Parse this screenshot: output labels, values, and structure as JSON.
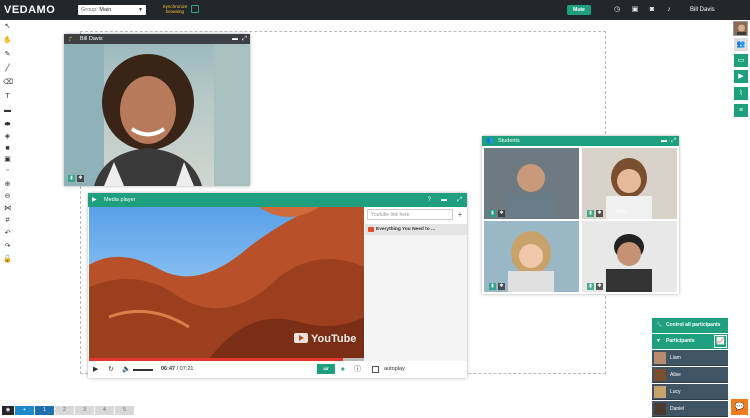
{
  "topbar": {
    "logo": "VEDAMO",
    "group_label": "Group:",
    "group_value": "Main",
    "sync_text": "Synchronize browsing",
    "mute_label": "Mute",
    "username": "Bill Davis"
  },
  "teacher_panel": {
    "title": "Bill Davis"
  },
  "students_panel": {
    "title": "Students",
    "students": [
      "",
      "Alise",
      "",
      ""
    ]
  },
  "media_player": {
    "title": "Media player",
    "help": "?",
    "link_placeholder": "Youtube link here",
    "playlist": [
      "Everything You Need to ..."
    ],
    "current_time": "06:47",
    "total_time": "07:21",
    "time_separator": "/",
    "progress": 0.923,
    "air_label": "air",
    "autoplay_label": "autoplay",
    "watermark": "YouTube"
  },
  "participants_panel": {
    "control_all": "Control all participants",
    "header": "Participants",
    "participants": [
      "Liam",
      "Alise",
      "Lucy",
      "Daniel"
    ]
  },
  "pages": {
    "add": "+",
    "items": [
      "1",
      "2",
      "3",
      "4",
      "5"
    ],
    "active": "1"
  },
  "icons": {
    "accent": "#1ea07f",
    "topbar_bg": "#23262b",
    "participant_row_bg": "#3f5566",
    "chat": "#f07d1a"
  }
}
